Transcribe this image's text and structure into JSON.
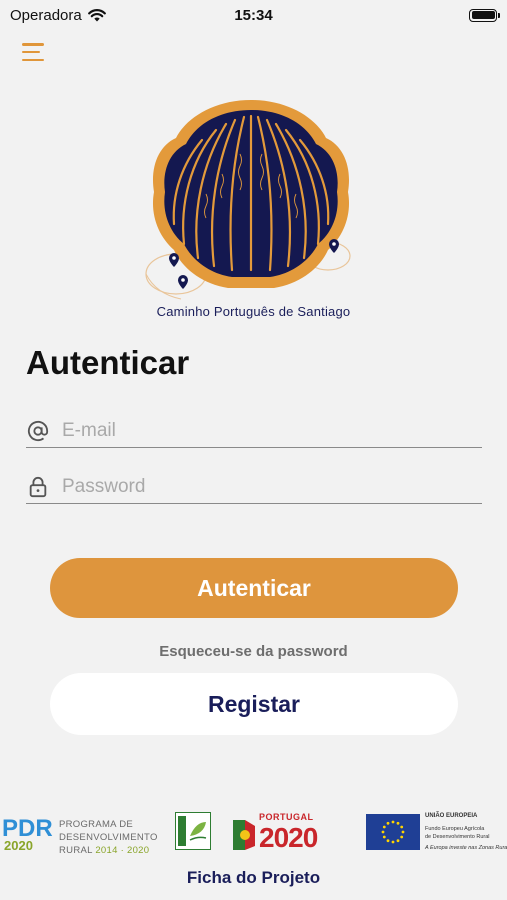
{
  "status_bar": {
    "carrier": "Operadora",
    "time": "15:34",
    "battery_level": 1.0
  },
  "header": {
    "menu_icon": "hamburger-menu-icon"
  },
  "logo": {
    "icon": "scallop-shell-logo",
    "caption": "Caminho Português de Santiago",
    "colors": {
      "shell_fill": "#141850",
      "shell_border": "#e39a3b"
    }
  },
  "page_title": "Autenticar",
  "form": {
    "email": {
      "icon": "at-sign-icon",
      "placeholder": "E-mail",
      "value": ""
    },
    "password": {
      "icon": "lock-icon",
      "placeholder": "Password",
      "value": ""
    }
  },
  "actions": {
    "login_label": "Autenticar",
    "forgot_label": "Esqueceu-se da password",
    "register_label": "Registar"
  },
  "footer": {
    "sponsors": {
      "pdr": {
        "mark": "PDR 2020",
        "line1": "PROGRAMA DE",
        "line2": "DESENVOLVIMENTO",
        "line3": "RURAL",
        "years": "2014 · 2020"
      },
      "leader": "LEADER",
      "portugal2020": {
        "label": "PORTUGAL",
        "year": "2020"
      },
      "eu": {
        "head": "UNIÃO EUROPEIA",
        "line1": "Fundo Europeu Agrícola",
        "line2": "de Desenvolvimento Rural",
        "line3": "A Europa investe nas Zonas Rurais"
      }
    },
    "project_link": "Ficha do Projeto"
  },
  "colors": {
    "accent": "#de953d",
    "brand_navy": "#1a1e5a",
    "background": "#f2f2f2"
  }
}
